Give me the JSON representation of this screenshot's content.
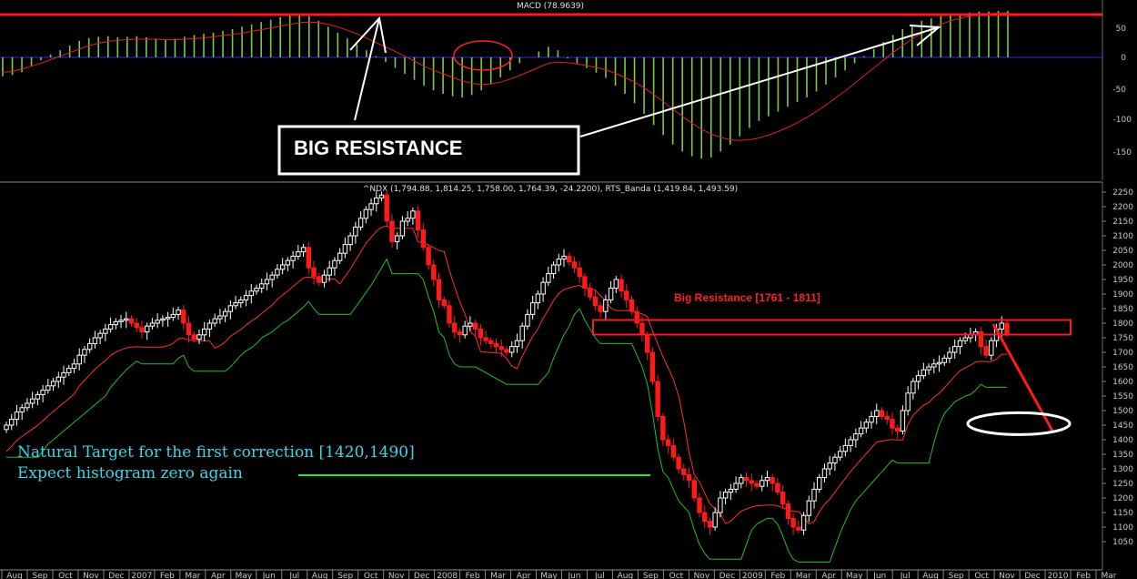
{
  "chart_data": [
    {
      "type": "bar",
      "pane": "macd",
      "title": "MACD (78.9639)",
      "y_ticks": [
        "50",
        "0",
        "-50",
        "-100",
        "-150"
      ],
      "ylim": [
        -180,
        82
      ],
      "reference_levels": {
        "upper_red_line": 69,
        "zero_line": 0
      },
      "colors": {
        "histogram": "#7ec850",
        "signal": "#e02020",
        "upper_line": "#ff1a1a",
        "zero_line": "#2a2aff"
      },
      "series": [
        {
          "values": [
            -32,
            -30,
            -25,
            -15,
            -5,
            5,
            12,
            20,
            28,
            33,
            35,
            36,
            34,
            35,
            36,
            34,
            32,
            30,
            32,
            35,
            38,
            40,
            42,
            45,
            48,
            52,
            56,
            60,
            64,
            68,
            72,
            74,
            70,
            62,
            52,
            42,
            32,
            22,
            12,
            2,
            -8,
            -18,
            -28,
            -38,
            -48,
            -56,
            -62,
            -66,
            -68,
            -64,
            -56,
            -46,
            -34,
            -22,
            -10,
            0,
            10,
            18,
            12,
            -2,
            -10,
            -18,
            -26,
            -35,
            -48,
            -62,
            -78,
            -96,
            -115,
            -132,
            -148,
            -160,
            -168,
            -172,
            -170,
            -160,
            -148,
            -134,
            -120,
            -108,
            -100,
            -92,
            -84,
            -76,
            -68,
            -58,
            -46,
            -34,
            -22,
            -10,
            2,
            14,
            26,
            38,
            48,
            56,
            62,
            66,
            70,
            72,
            74,
            76,
            78,
            78,
            79,
            79
          ]
        },
        {
          "name": "signal",
          "values": [
            -25,
            -24,
            -20,
            -15,
            -10,
            -4,
            2,
            8,
            14,
            20,
            24,
            27,
            29,
            30,
            31,
            31,
            31,
            30,
            30,
            31,
            32,
            33,
            35,
            37,
            39,
            41,
            44,
            47,
            50,
            53,
            56,
            59,
            60,
            59,
            56,
            52,
            46,
            40,
            33,
            25,
            18,
            10,
            2,
            -6,
            -15,
            -22,
            -28,
            -34,
            -40,
            -44,
            -46,
            -45,
            -42,
            -37,
            -31,
            -24,
            -17,
            -10,
            -8,
            -9,
            -11,
            -14,
            -17,
            -21,
            -27,
            -34,
            -42,
            -52,
            -63,
            -75,
            -88,
            -100,
            -112,
            -122,
            -130,
            -136,
            -140,
            -141,
            -140,
            -137,
            -132,
            -126,
            -119,
            -111,
            -102,
            -92,
            -81,
            -69,
            -57,
            -44,
            -31,
            -18,
            -5,
            8,
            20,
            31,
            41,
            49,
            56,
            62,
            66,
            70,
            72,
            74,
            75,
            76
          ]
        }
      ]
    },
    {
      "type": "candlestick",
      "pane": "price",
      "title": "^NDX (1,794.88, 1,814.25, 1,758.00, 1,764.39, -24.2200), RTS_Banda (1,419.84, 1,493.59)",
      "y_ticks": [
        "2250",
        "2200",
        "2150",
        "2100",
        "2050",
        "2000",
        "1950",
        "1900",
        "1850",
        "1800",
        "1750",
        "1700",
        "1650",
        "1600",
        "1550",
        "1500",
        "1450",
        "1400",
        "1350",
        "1300",
        "1250",
        "1200",
        "1150",
        "1100",
        "1050"
      ],
      "ylim": [
        1030,
        2260
      ],
      "x_ticks": [
        "Aug",
        "Sep",
        "Oct",
        "Nov",
        "Dec",
        "2007",
        "Feb",
        "Mar",
        "Apr",
        "May",
        "Jun",
        "Jul",
        "Aug",
        "Sep",
        "Oct",
        "Nov",
        "Dec",
        "2008",
        "Feb",
        "Mar",
        "Apr",
        "May",
        "Jun",
        "Jul",
        "Aug",
        "Sep",
        "Oct",
        "Nov",
        "Dec",
        "2009",
        "Feb",
        "Mar",
        "Apr",
        "May",
        "Jun",
        "Jul",
        "Aug",
        "Sep",
        "Oct",
        "Nov",
        "Dec",
        "2010",
        "Feb",
        "Mar"
      ],
      "closes": [
        1450,
        1470,
        1495,
        1510,
        1525,
        1540,
        1555,
        1570,
        1585,
        1600,
        1615,
        1630,
        1645,
        1660,
        1690,
        1710,
        1730,
        1750,
        1765,
        1780,
        1795,
        1805,
        1810,
        1815,
        1800,
        1785,
        1770,
        1790,
        1800,
        1810,
        1815,
        1820,
        1830,
        1845,
        1800,
        1760,
        1745,
        1760,
        1780,
        1800,
        1815,
        1825,
        1840,
        1860,
        1870,
        1880,
        1895,
        1910,
        1920,
        1935,
        1950,
        1965,
        1985,
        2000,
        2015,
        2030,
        2045,
        2060,
        1990,
        1960,
        1940,
        1965,
        1990,
        2015,
        2040,
        2070,
        2100,
        2130,
        2160,
        2190,
        2210,
        2230,
        2240,
        2150,
        2080,
        2100,
        2150,
        2160,
        2185,
        2120,
        2060,
        2000,
        1950,
        1880,
        1860,
        1800,
        1770,
        1760,
        1790,
        1800,
        1780,
        1750,
        1740,
        1730,
        1720,
        1710,
        1700,
        1720,
        1740,
        1790,
        1830,
        1870,
        1900,
        1940,
        1970,
        2000,
        2020,
        2030,
        2010,
        1990,
        1960,
        1920,
        1890,
        1860,
        1840,
        1880,
        1920,
        1950,
        1910,
        1880,
        1840,
        1800,
        1760,
        1700,
        1600,
        1480,
        1400,
        1380,
        1340,
        1300,
        1280,
        1260,
        1200,
        1150,
        1120,
        1100,
        1150,
        1200,
        1220,
        1230,
        1250,
        1270,
        1260,
        1250,
        1240,
        1260,
        1270,
        1250,
        1220,
        1180,
        1130,
        1100,
        1090,
        1140,
        1190,
        1230,
        1270,
        1300,
        1320,
        1340,
        1360,
        1380,
        1400,
        1420,
        1440,
        1460,
        1480,
        1500,
        1480,
        1470,
        1440,
        1430,
        1500,
        1560,
        1600,
        1620,
        1640,
        1650,
        1660,
        1665,
        1680,
        1700,
        1720,
        1740,
        1750,
        1760,
        1770,
        1720,
        1690,
        1740,
        1780,
        1800,
        1764
      ],
      "resistance_zone": [
        1761,
        1811
      ],
      "target_zone": [
        1420,
        1490
      ],
      "colors": {
        "up_candle": "#ffffff",
        "down_candle": "#ff1a1a",
        "band_upper": "#ff3030",
        "band_lower": "#22c022"
      }
    }
  ],
  "annotations": {
    "macd_box_text": "BIG RESISTANCE",
    "price_resistance_label": "Big Resistance [1761 - 1811]",
    "target_line_1": "Natural Target  for the first correction [1420,1490]",
    "target_line_2": "Expect histogram zero again"
  }
}
